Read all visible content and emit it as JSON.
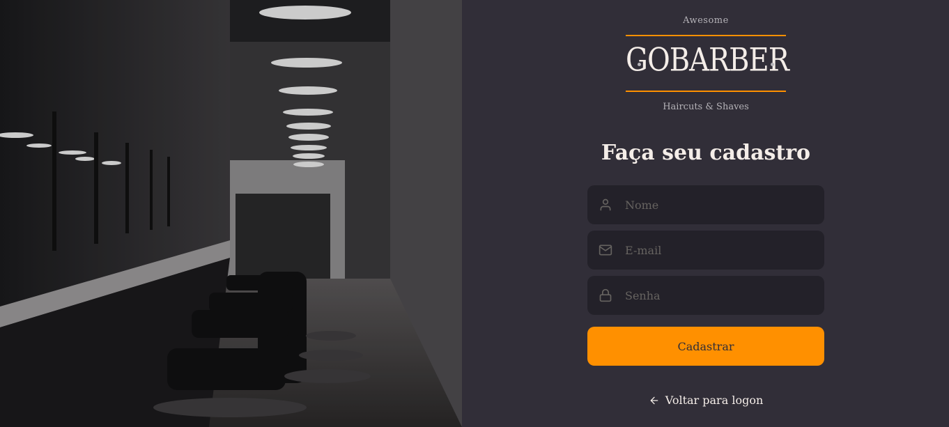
{
  "logo": {
    "top_text": "Awesome",
    "wordmark": "GOBARBER",
    "bottom_text": "Haircuts & Shaves"
  },
  "form": {
    "title": "Faça seu cadastro",
    "name_placeholder": "Nome",
    "email_placeholder": "E-mail",
    "password_placeholder": "Senha",
    "submit_label": "Cadastrar"
  },
  "back_link": {
    "label": "Voltar para logon"
  },
  "colors": {
    "accent": "#ff9000",
    "background": "#312e38",
    "input_background": "#232129",
    "text": "#f4ede8",
    "muted": "#666360"
  },
  "icons": {
    "name_field": "user-icon",
    "email_field": "mail-icon",
    "password_field": "lock-icon",
    "back": "arrow-left-icon"
  }
}
